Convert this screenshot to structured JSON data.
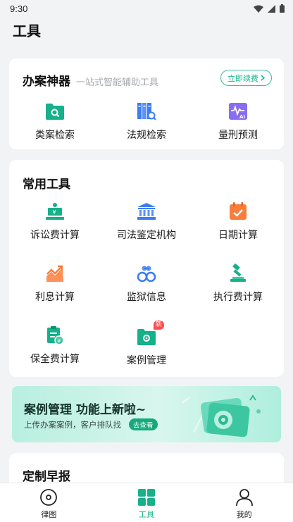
{
  "status_bar": {
    "time": "9:30"
  },
  "page": {
    "title": "工具"
  },
  "main_tools": {
    "title": "办案神器",
    "subtitle": "一站式智能辅助工具",
    "renew_label": "立即续费",
    "items": [
      {
        "label": "类案检索",
        "icon": "folder-search-icon"
      },
      {
        "label": "法规检索",
        "icon": "law-books-icon"
      },
      {
        "label": "量刑预测",
        "icon": "ai-chart-icon"
      }
    ]
  },
  "common_tools": {
    "title": "常用工具",
    "items": [
      {
        "label": "诉讼费计算",
        "icon": "litigation-fee-icon"
      },
      {
        "label": "司法鉴定机构",
        "icon": "institution-icon"
      },
      {
        "label": "日期计算",
        "icon": "calendar-icon"
      },
      {
        "label": "利息计算",
        "icon": "interest-chart-icon"
      },
      {
        "label": "监狱信息",
        "icon": "handcuffs-icon"
      },
      {
        "label": "执行费计算",
        "icon": "gavel-icon"
      },
      {
        "label": "保全费计算",
        "icon": "clipboard-money-icon"
      },
      {
        "label": "案例管理",
        "icon": "case-folder-icon",
        "badge": "新"
      }
    ]
  },
  "banner": {
    "title": "案例管理  功能上新啦~",
    "subtitle": "上传办案案例，客户排队找",
    "button": "去查看"
  },
  "report": {
    "title": "定制早报"
  },
  "tabs": [
    {
      "label": "律图",
      "icon": "compass-icon",
      "active": false
    },
    {
      "label": "工具",
      "icon": "grid-icon",
      "active": true
    },
    {
      "label": "我的",
      "icon": "user-icon",
      "active": false
    }
  ],
  "colors": {
    "accent": "#16b08a",
    "blue": "#3d7cf2",
    "orange": "#fa7d3c",
    "purple": "#8a6cf0"
  }
}
